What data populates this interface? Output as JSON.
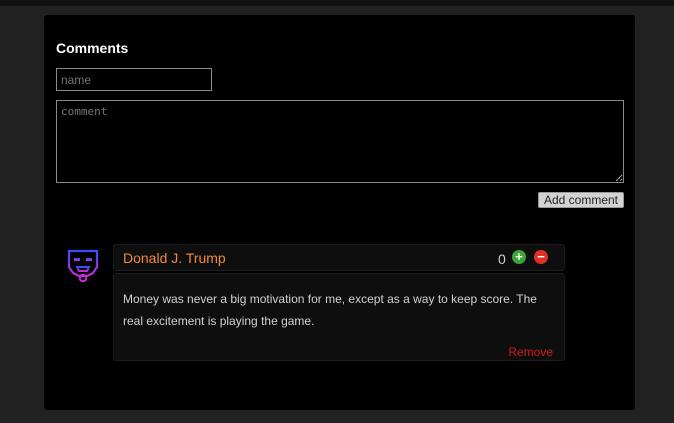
{
  "comments_section": {
    "heading": "Comments",
    "name_placeholder": "name",
    "comment_placeholder": "comment",
    "add_button_label": "Add comment"
  },
  "comments": [
    {
      "author": "Donald J. Trump",
      "author_color": "#f28a3a",
      "avatar_icon": "pixel-mask-icon",
      "votes": "0",
      "upvote_icon": "plus-circle-icon",
      "downvote_icon": "minus-circle-icon",
      "text": "Money was never a big motivation for me, except as a way to keep score. The real excitement is playing the game.",
      "remove_label": "Remove"
    }
  ],
  "colors": {
    "background": "#212121",
    "panel": "#000000",
    "upvote": "#3aa53a",
    "downvote": "#e0302a",
    "remove": "#d11a1a"
  }
}
